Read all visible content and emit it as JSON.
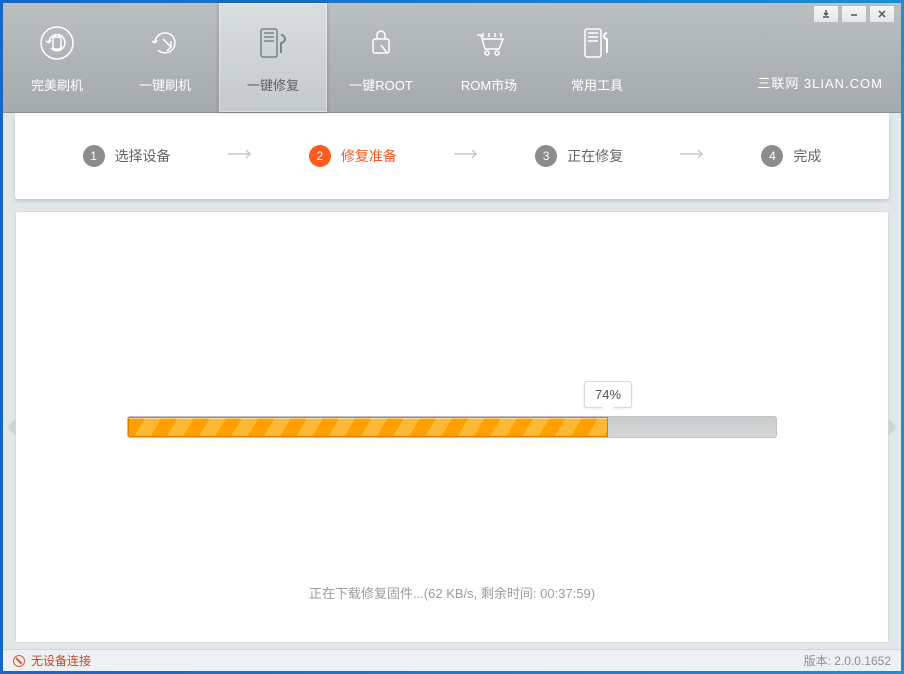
{
  "window_controls": {
    "pin_tip": "pin",
    "min_tip": "minimize",
    "close_tip": "close"
  },
  "toolbar": {
    "items": [
      {
        "label": "完美刷机",
        "icon": "android-refresh"
      },
      {
        "label": "一键刷机",
        "icon": "touch-refresh"
      },
      {
        "label": "一键修复",
        "icon": "phone-wrench",
        "active": true
      },
      {
        "label": "一键ROOT",
        "icon": "lock-touch"
      },
      {
        "label": "ROM市场",
        "icon": "cart"
      },
      {
        "label": "常用工具",
        "icon": "phone-tool"
      }
    ],
    "brand": "三联网 3LIAN.COM"
  },
  "steps": [
    {
      "num": "1",
      "label": "选择设备"
    },
    {
      "num": "2",
      "label": "修复准备",
      "current": true
    },
    {
      "num": "3",
      "label": "正在修复"
    },
    {
      "num": "4",
      "label": "完成"
    }
  ],
  "progress": {
    "percent": 74,
    "tooltip": "74%"
  },
  "status_text": "正在下载修复固件...(62 KB/s, 剩余时间: 00:37:59)",
  "footer": {
    "no_device": "无设备连接",
    "version_label": "版本: 2.0.0.1652"
  }
}
